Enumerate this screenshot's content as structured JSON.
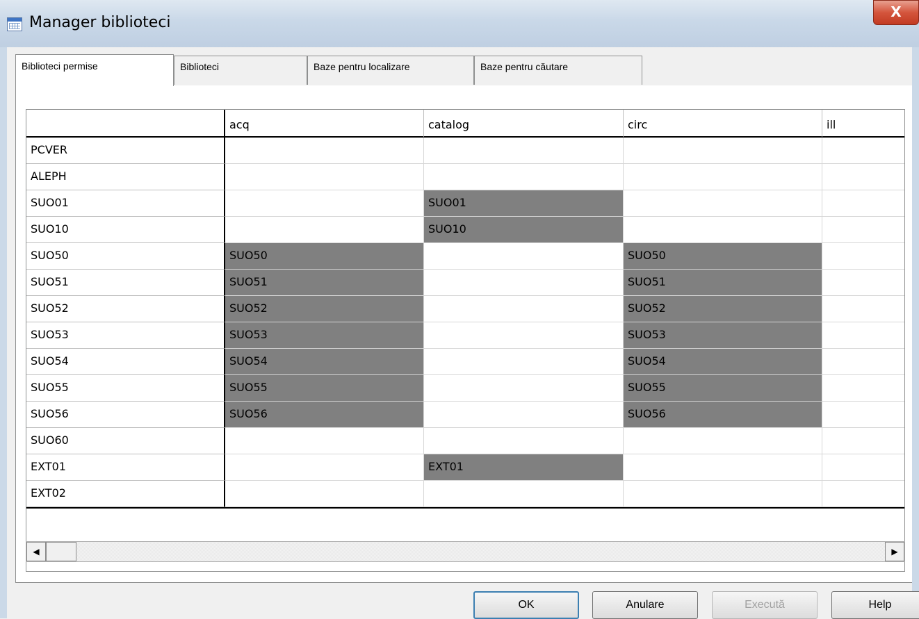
{
  "window": {
    "title": "Manager biblioteci",
    "close_label": "X"
  },
  "tabs": [
    {
      "label": "Biblioteci permise",
      "active": true
    },
    {
      "label": "Biblioteci",
      "active": false
    },
    {
      "label": "Baze pentru localizare",
      "active": false
    },
    {
      "label": "Baze pentru căutare",
      "active": false
    }
  ],
  "grid": {
    "columns": [
      "acq",
      "catalog",
      "circ",
      "ill"
    ],
    "rows": [
      {
        "label": "PCVER",
        "cells": [
          "",
          "",
          "",
          ""
        ]
      },
      {
        "label": "ALEPH",
        "cells": [
          "",
          "",
          "",
          ""
        ]
      },
      {
        "label": "SUO01",
        "cells": [
          "",
          "SUO01",
          "",
          ""
        ]
      },
      {
        "label": "SUO10",
        "cells": [
          "",
          "SUO10",
          "",
          ""
        ]
      },
      {
        "label": "SUO50",
        "cells": [
          "SUO50",
          "",
          "SUO50",
          ""
        ]
      },
      {
        "label": "SUO51",
        "cells": [
          "SUO51",
          "",
          "SUO51",
          ""
        ]
      },
      {
        "label": "SUO52",
        "cells": [
          "SUO52",
          "",
          "SUO52",
          ""
        ]
      },
      {
        "label": "SUO53",
        "cells": [
          "SUO53",
          "",
          "SUO53",
          ""
        ]
      },
      {
        "label": "SUO54",
        "cells": [
          "SUO54",
          "",
          "SUO54",
          ""
        ]
      },
      {
        "label": "SUO55",
        "cells": [
          "SUO55",
          "",
          "SUO55",
          ""
        ]
      },
      {
        "label": "SUO56",
        "cells": [
          "SUO56",
          "",
          "SUO56",
          ""
        ]
      },
      {
        "label": "SUO60",
        "cells": [
          "",
          "",
          "",
          ""
        ]
      },
      {
        "label": "EXT01",
        "cells": [
          "",
          "EXT01",
          "",
          ""
        ]
      },
      {
        "label": "EXT02",
        "cells": [
          "",
          "",
          "",
          ""
        ]
      }
    ],
    "filled_color": "#808080"
  },
  "scrollbar": {
    "left_arrow": "◀",
    "right_arrow": "▶"
  },
  "buttons": {
    "ok": "OK",
    "cancel": "Anulare",
    "execute": "Execută",
    "help": "Help"
  }
}
